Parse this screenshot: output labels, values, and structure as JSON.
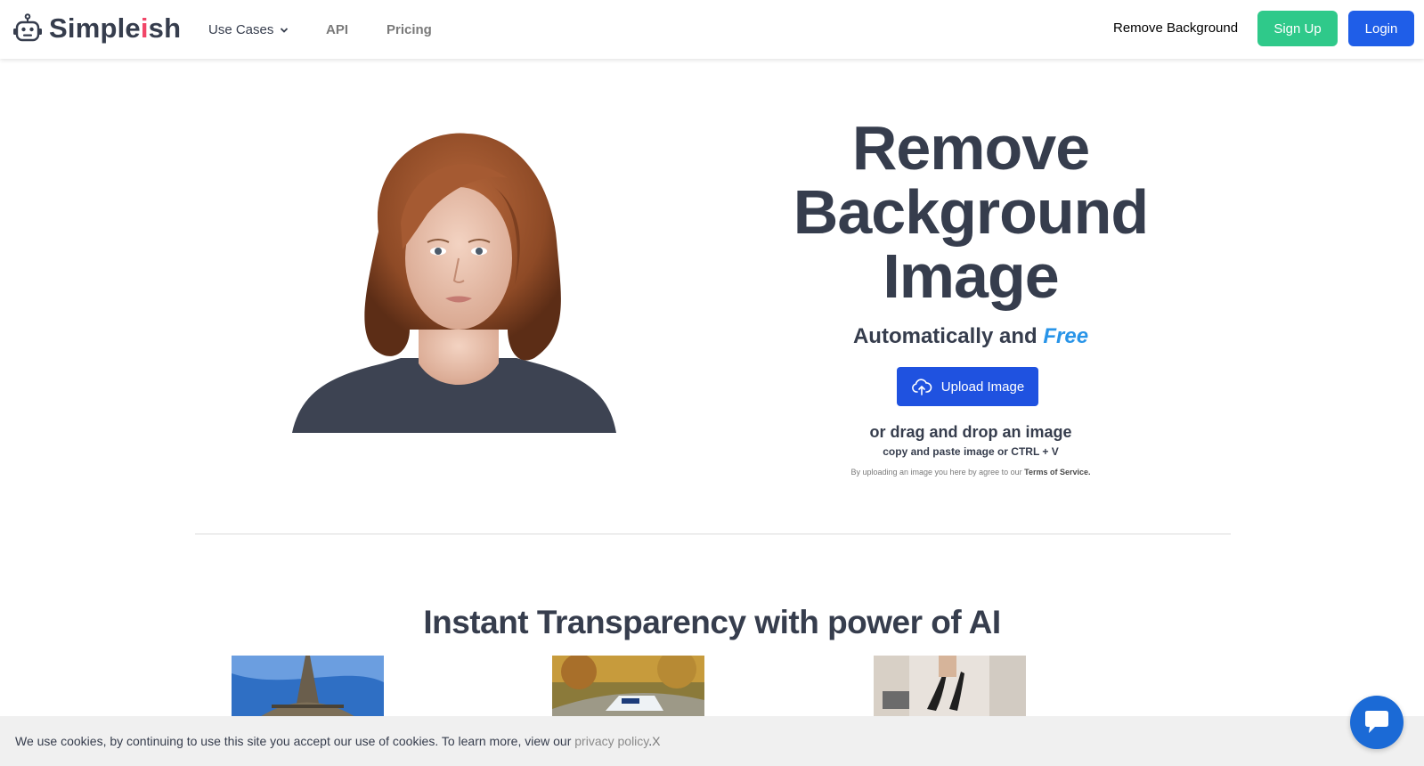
{
  "brand": {
    "name_part1": "Simple",
    "name_accent": "i",
    "name_part2": "sh",
    "logo_icon": "robot-icon"
  },
  "nav": {
    "use_cases": "Use Cases",
    "api": "API",
    "pricing": "Pricing",
    "remove_background": "Remove Background",
    "sign_up": "Sign Up",
    "login": "Login"
  },
  "hero": {
    "title_line1": "Remove",
    "title_line2": "Background",
    "title_line3": "Image",
    "subtitle_prefix": "Automatically and",
    "subtitle_accent": "Free",
    "upload_label": "Upload Image",
    "drag_text": "or drag and drop an image",
    "paste_text": "copy and paste image or CTRL + V",
    "tos_prefix": "By uploading an image you here by agree to our",
    "tos_link": "Terms of Service."
  },
  "section": {
    "title": "Instant Transparency with power of AI"
  },
  "cookie": {
    "text": "We use cookies, by continuing to use this site you accept our use of cookies. To learn more, view our",
    "link": "privacy policy",
    "period": ".",
    "close": "X"
  },
  "colors": {
    "brand_text": "#363d4d",
    "brand_accent": "#f14668",
    "signup": "#2fc98a",
    "login": "#1f5ee8",
    "upload": "#1f52e0",
    "free": "#2894e8",
    "chat": "#1b6ad6"
  }
}
